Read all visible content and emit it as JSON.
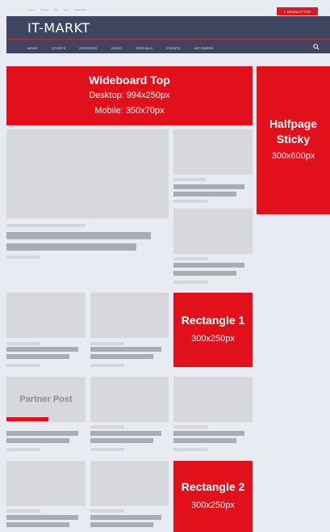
{
  "topbar": {
    "links": [
      "Epaper",
      "IT Pager",
      "Abo",
      "Shop",
      "Mediadaten"
    ],
    "newsletter_label": "» NEWSLETTER"
  },
  "header": {
    "brand": "IT-MARKT",
    "nav": [
      "NEWS",
      "STORYS",
      "DOSSIERS",
      "VIDEO",
      "SPECIALS",
      "EVENTS",
      "NETZWERK"
    ],
    "search_icon": "search-icon"
  },
  "ads": {
    "wideboard": {
      "title": "Wideboard Top",
      "line1": "Desktop: 994x250px",
      "line2": "Mobile: 350x70px"
    },
    "halfpage": {
      "title_line1": "Halfpage",
      "title_line2": "Sticky",
      "size": "300x600px"
    },
    "rect1": {
      "title": "Rectangle 1",
      "size": "300x250px"
    },
    "rect2": {
      "title": "Rectangle 2",
      "size": "300x250px"
    }
  },
  "content": {
    "partner_label": "Partner Post"
  },
  "colors": {
    "page_bg": "#e8ebf1",
    "header_bg": "#3d4561",
    "ad_red": "#e2101a",
    "placeholder": "#d6d8dd",
    "text_bar": "#a9acb2"
  }
}
